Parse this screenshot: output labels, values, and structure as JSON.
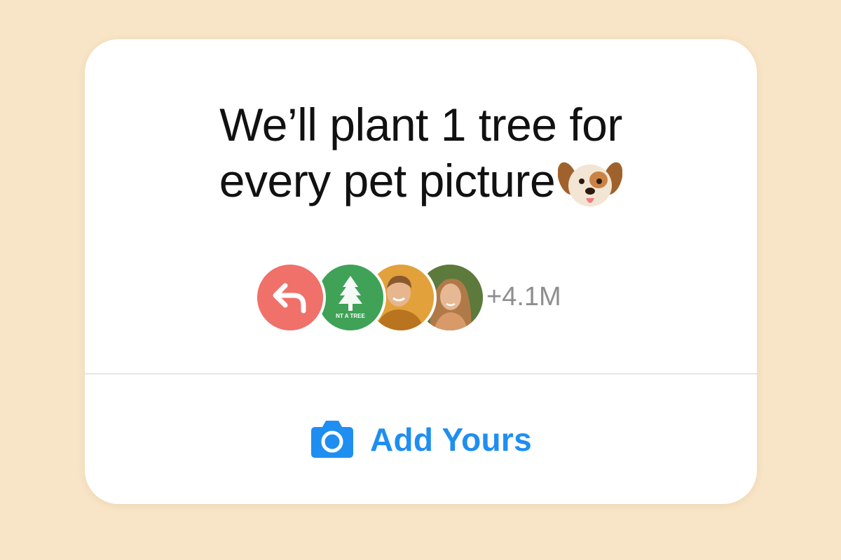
{
  "prompt": {
    "line1": "We’ll plant 1 tree for",
    "line2": "every pet picture",
    "emoji": "dog-face-emoji"
  },
  "participants": {
    "avatars": [
      "reply-arrow-icon",
      "plant-a-tree-logo",
      "participant-photo-1",
      "participant-photo-2"
    ],
    "logo_text": "NT A TREE",
    "count": "+4.1M"
  },
  "action": {
    "icon": "camera-icon",
    "label": "Add Yours"
  },
  "colors": {
    "background": "#F8E4C6",
    "card": "#FFFFFF",
    "accent": "#1F8EF1",
    "reply_avatar": "#F0706A",
    "tree_avatar": "#3FA257",
    "count_text": "#8E8E8E"
  }
}
